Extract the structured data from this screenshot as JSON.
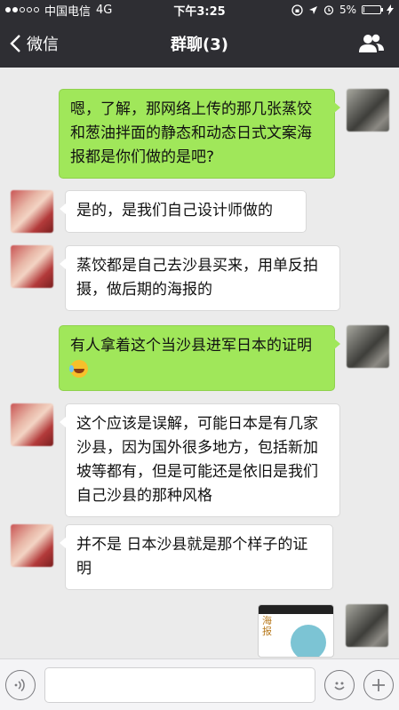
{
  "status_bar": {
    "carrier": "中国电信",
    "network": "4G",
    "time": "下午3:25",
    "battery": "5%",
    "battery_level": 0.05
  },
  "nav": {
    "back_label": "微信",
    "title": "群聊(3)"
  },
  "messages": [
    {
      "side": "out",
      "avatar": "male",
      "text": "嗯，了解，那网络上传的那几张蒸饺和葱油拌面的静态和动态日式文案海报都是你们做的是吧?"
    },
    {
      "side": "in",
      "avatar": "female",
      "text": "是的，是我们自己设计师做的"
    },
    {
      "side": "in",
      "avatar": "female",
      "text": "蒸饺都是自己去沙县买来，用单反拍摄，做后期的海报的"
    },
    {
      "side": "out",
      "avatar": "male",
      "text": "有人拿着这个当沙县进军日本的证明",
      "emoji": "laughing-tears-emoji"
    },
    {
      "side": "in",
      "avatar": "female",
      "text": "这个应该是误解，可能日本是有几家沙县，因为国外很多地方，包括新加坡等都有，但是可能还是依旧是我们自己沙县的那种风格"
    },
    {
      "side": "in",
      "avatar": "female",
      "text": "并不是 日本沙县就是那个样子的证明"
    },
    {
      "side": "out",
      "avatar": "male",
      "image": "poster-thumbnail",
      "image_title": "海报"
    }
  ],
  "input_bar": {
    "voice_icon": "voice-icon",
    "emoji_icon": "smiley-icon",
    "add_icon": "plus-icon"
  },
  "colors": {
    "header_bg": "#2e2e33",
    "chat_bg": "#ebebeb",
    "outgoing_bubble": "#a0e75a",
    "incoming_bubble": "#ffffff"
  }
}
